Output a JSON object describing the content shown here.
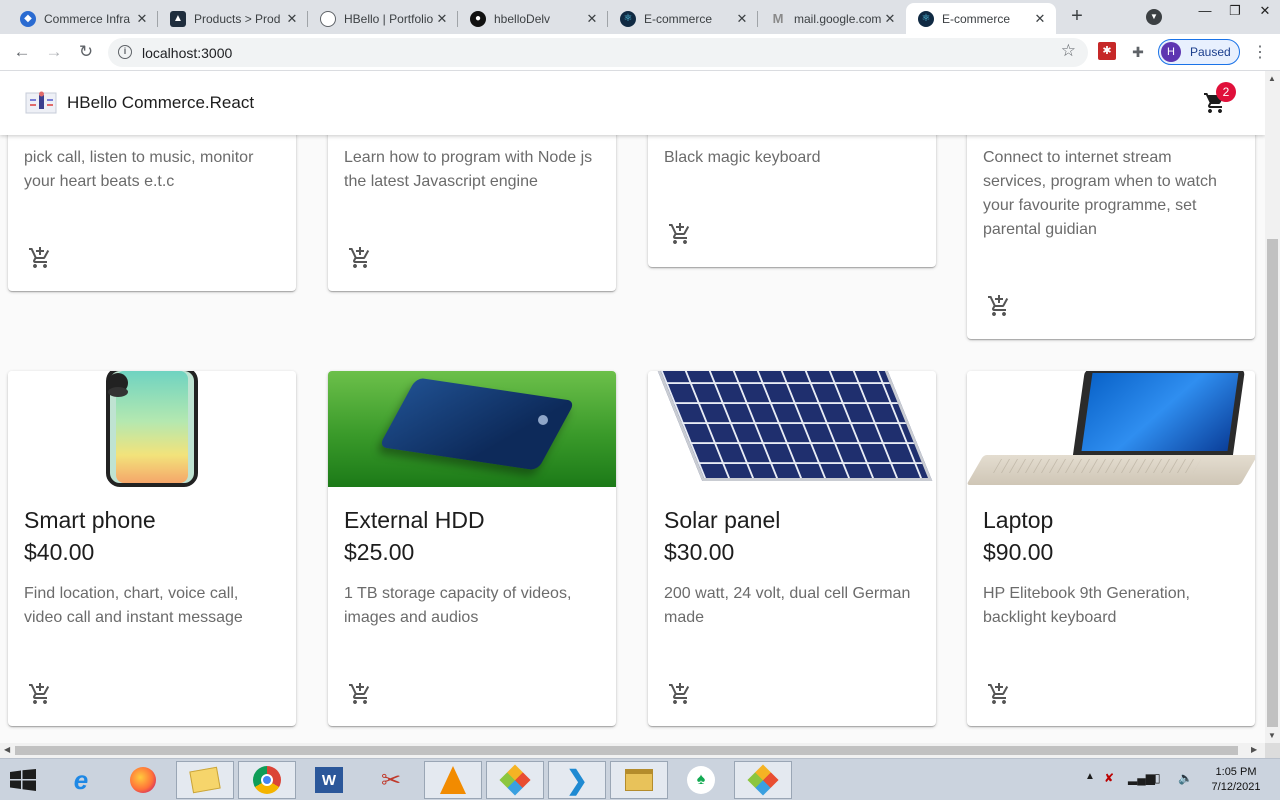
{
  "browser": {
    "tabs": [
      {
        "title": "Commerce Infra",
        "icon": "commerce-logo-icon",
        "color": "#2a6bd1"
      },
      {
        "title": "Products > Prod",
        "icon": "products-logo-icon",
        "color": "#1f2d3d"
      },
      {
        "title": "HBello | Portfolio",
        "icon": "globe-icon",
        "color": "#5f6368"
      },
      {
        "title": "hbelloDelv",
        "icon": "github-icon",
        "color": "#111111"
      },
      {
        "title": "E-commerce",
        "icon": "react-icon",
        "color": "#102a43"
      },
      {
        "title": "mail.google.com",
        "icon": "gmail-icon",
        "color": "#8a8a8a"
      },
      {
        "title": "E-commerce",
        "icon": "react-icon",
        "color": "#102a43"
      }
    ],
    "address": "localhost:3000",
    "profile_initial": "H",
    "profile_label": "Paused"
  },
  "app": {
    "brand": "HBello Commerce.React",
    "cart_count": "2",
    "accent": "#e0103a"
  },
  "products_top": [
    {
      "desc": "pick call, listen to music, monitor your heart beats e.t.c"
    },
    {
      "desc": "Learn how to program with Node js the latest Javascript engine"
    },
    {
      "desc": "Black magic keyboard"
    },
    {
      "desc": "Connect to internet stream services, program when to watch your favourite programme, set parental guidian"
    }
  ],
  "products": [
    {
      "name": "Smart phone",
      "price": "$40.00",
      "desc": "Find location, chart, voice call, video call and instant message",
      "image": "smartphone-image"
    },
    {
      "name": "External HDD",
      "price": "$25.00",
      "desc": "1 TB storage capacity of videos, images and audios",
      "image": "external-hdd-image"
    },
    {
      "name": "Solar panel",
      "price": "$30.00",
      "desc": "200 watt, 24 volt, dual cell German made",
      "image": "solar-panel-image"
    },
    {
      "name": "Laptop",
      "price": "$90.00",
      "desc": "HP Elitebook 9th Generation, backlight keyboard",
      "image": "laptop-image"
    }
  ],
  "taskbar": {
    "apps": [
      "ie-icon",
      "firefox-icon",
      "file-manager-icon",
      "chrome-icon",
      "word-icon",
      "snipping-icon",
      "vlc-icon",
      "git-icon",
      "vscode-icon",
      "explorer-icon",
      "mongodb-icon",
      "git-gui-icon"
    ],
    "time": "1:05 PM",
    "date": "7/12/2021"
  }
}
